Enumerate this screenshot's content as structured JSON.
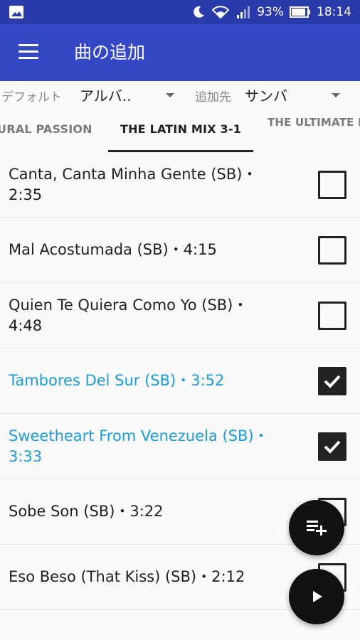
{
  "status_bar": {
    "battery_percent": "93%",
    "time": "18:14",
    "icons": [
      "image-icon",
      "moon-icon",
      "wifi-icon",
      "signal-icon",
      "battery-icon"
    ]
  },
  "app_bar": {
    "title": "曲の追加",
    "menu_icon": "hamburger-menu-icon"
  },
  "filter": {
    "sort_label": "デフォルト",
    "sort_value": "アルバ..",
    "dest_label": "追加先",
    "dest_value": "サンバ"
  },
  "tabs": [
    {
      "label": "URAL PASSION"
    },
    {
      "label": "THE LATIN MIX 3-1"
    },
    {
      "label": "THE ULTIMATE LA"
    }
  ],
  "songs": [
    {
      "line1": "Canta, Canta Minha Gente (SB)・",
      "line2": "2:35",
      "checked": false
    },
    {
      "line1": "Mal Acostumada (SB)・4:15",
      "line2": "",
      "checked": false
    },
    {
      "line1": "Quien Te Quiera Como Yo (SB)・",
      "line2": "4:48",
      "checked": false
    },
    {
      "line1": "Tambores Del Sur (SB)・3:52",
      "line2": "",
      "checked": true
    },
    {
      "line1": "Sweetheart From Venezuela (SB)・",
      "line2": "3:33",
      "checked": true
    },
    {
      "line1": "Sobe Son (SB)・3:22",
      "line2": "",
      "checked": false
    },
    {
      "line1": "Eso Beso (That Kiss) (SB)・2:12",
      "line2": "",
      "checked": false
    }
  ],
  "fabs": {
    "add_icon": "playlist-add-icon",
    "play_icon": "play-icon"
  },
  "colors": {
    "status_bar": "#2a3aa8",
    "app_bar": "#3448c5",
    "selected_text": "#1e9ad6",
    "fab": "#111111"
  }
}
